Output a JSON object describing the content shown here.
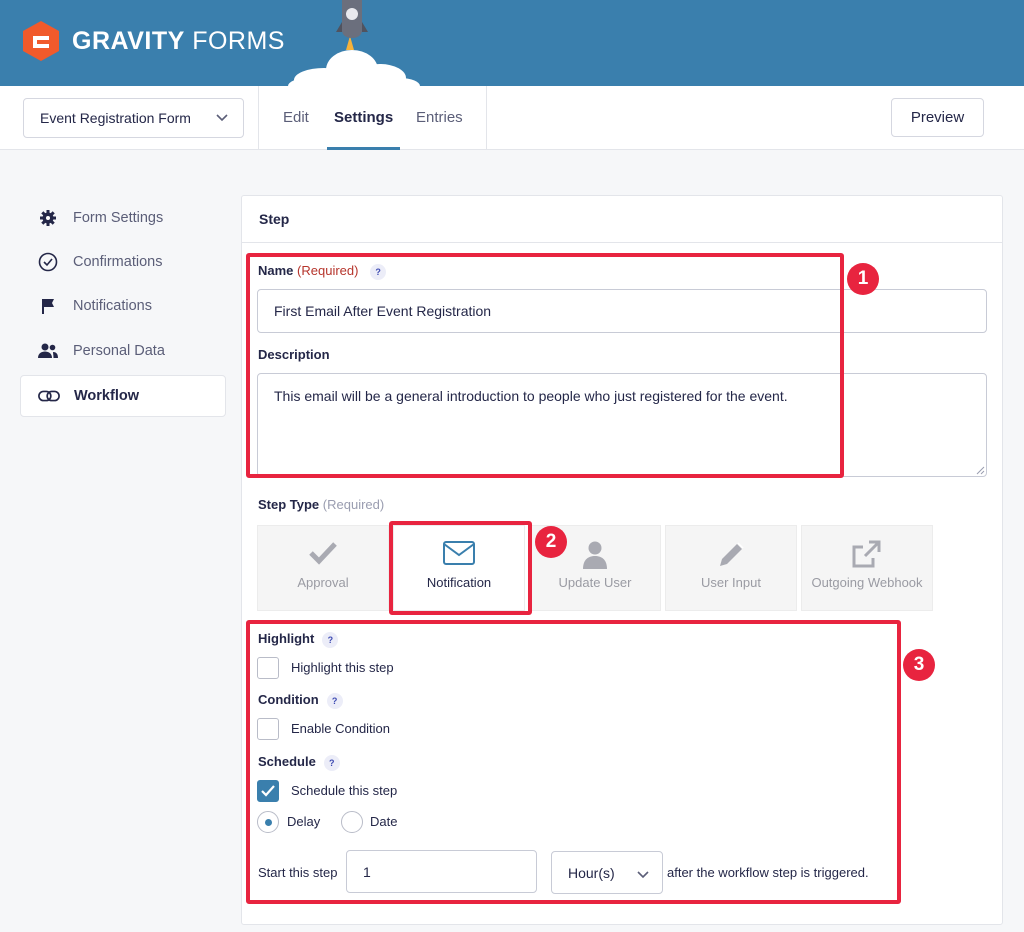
{
  "brand": {
    "name_bold": "GRAVITY",
    "name_light": " FORMS"
  },
  "toolbar": {
    "form_selector": "Event Registration Form",
    "tabs": [
      "Edit",
      "Settings",
      "Entries"
    ],
    "active_tab": "Settings",
    "preview_label": "Preview"
  },
  "sidebar": {
    "items": [
      {
        "label": "Form Settings",
        "icon": "gear-icon"
      },
      {
        "label": "Confirmations",
        "icon": "check-circle-icon"
      },
      {
        "label": "Notifications",
        "icon": "flag-icon"
      },
      {
        "label": "Personal Data",
        "icon": "people-icon"
      },
      {
        "label": "Workflow",
        "icon": "link-icon"
      }
    ],
    "active": "Workflow"
  },
  "step": {
    "section_title": "Step",
    "name_label": "Name",
    "name_required": "(Required)",
    "help": "?",
    "name_value": "First Email After Event Registration",
    "description_label": "Description",
    "description_value": "This email will be a general introduction to people who just registered for the event.",
    "step_type_label": "Step Type",
    "step_type_required": "(Required)",
    "step_types": [
      {
        "label": "Approval",
        "icon": "check-icon"
      },
      {
        "label": "Notification",
        "icon": "envelope-icon"
      },
      {
        "label": "Update User",
        "icon": "user-icon"
      },
      {
        "label": "User Input",
        "icon": "pencil-icon"
      },
      {
        "label": "Outgoing Webhook",
        "icon": "external-link-icon"
      }
    ],
    "selected_step_type": "Notification",
    "highlight_label": "Highlight",
    "highlight_checkbox": "Highlight this step",
    "condition_label": "Condition",
    "condition_checkbox": "Enable Condition",
    "schedule_label": "Schedule",
    "schedule_checkbox": "Schedule this step",
    "schedule_checked": true,
    "radio_delay": "Delay",
    "radio_date": "Date",
    "start_prefix": "Start this step",
    "start_value": "1",
    "unit_value": "Hour(s)",
    "start_suffix": "after the workflow step is triggered."
  },
  "annotations": [
    "1",
    "2",
    "3"
  ],
  "colors": {
    "header": "#3a7fad",
    "accent": "#3a7fad",
    "annotation": "#e8243f",
    "required": "#b6352c"
  }
}
